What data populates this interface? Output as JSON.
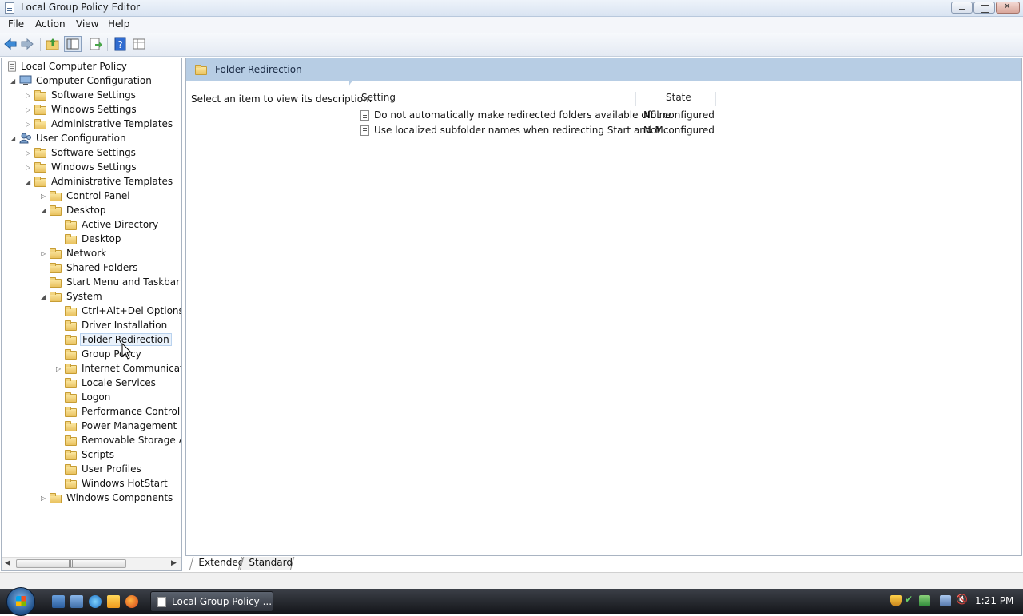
{
  "window": {
    "title": "Local Group Policy Editor"
  },
  "menu": [
    "File",
    "Action",
    "View",
    "Help"
  ],
  "tree": {
    "root": "Local Computer Policy",
    "items": [
      {
        "label": "Computer Configuration",
        "level": 1,
        "expander": "expanded",
        "icon": "computer-icon"
      },
      {
        "label": "Software Settings",
        "level": 2,
        "expander": "collapsed",
        "icon": "folder-icon"
      },
      {
        "label": "Windows Settings",
        "level": 2,
        "expander": "collapsed",
        "icon": "folder-icon"
      },
      {
        "label": "Administrative Templates",
        "level": 2,
        "expander": "collapsed",
        "icon": "folder-icon"
      },
      {
        "label": "User Configuration",
        "level": 1,
        "expander": "expanded",
        "icon": "user-icon"
      },
      {
        "label": "Software Settings",
        "level": 2,
        "expander": "collapsed",
        "icon": "folder-icon"
      },
      {
        "label": "Windows Settings",
        "level": 2,
        "expander": "collapsed",
        "icon": "folder-icon"
      },
      {
        "label": "Administrative Templates",
        "level": 2,
        "expander": "expanded",
        "icon": "folder-icon"
      },
      {
        "label": "Control Panel",
        "level": 3,
        "expander": "collapsed",
        "icon": "folder-icon"
      },
      {
        "label": "Desktop",
        "level": 3,
        "expander": "expanded",
        "icon": "folder-icon"
      },
      {
        "label": "Active Directory",
        "level": 4,
        "expander": "none",
        "icon": "folder-icon"
      },
      {
        "label": "Desktop",
        "level": 4,
        "expander": "none",
        "icon": "folder-icon"
      },
      {
        "label": "Network",
        "level": 3,
        "expander": "collapsed",
        "icon": "folder-icon"
      },
      {
        "label": "Shared Folders",
        "level": 3,
        "expander": "none",
        "icon": "folder-icon"
      },
      {
        "label": "Start Menu and Taskbar",
        "level": 3,
        "expander": "none",
        "icon": "folder-icon"
      },
      {
        "label": "System",
        "level": 3,
        "expander": "expanded",
        "icon": "folder-icon"
      },
      {
        "label": "Ctrl+Alt+Del Options",
        "level": 4,
        "expander": "none",
        "icon": "folder-icon"
      },
      {
        "label": "Driver Installation",
        "level": 4,
        "expander": "none",
        "icon": "folder-icon"
      },
      {
        "label": "Folder Redirection",
        "level": 4,
        "expander": "none",
        "icon": "folder-icon",
        "selected": true
      },
      {
        "label": "Group Policy",
        "level": 4,
        "expander": "none",
        "icon": "folder-icon"
      },
      {
        "label": "Internet Communicatio",
        "level": 4,
        "expander": "collapsed",
        "icon": "folder-icon"
      },
      {
        "label": "Locale Services",
        "level": 4,
        "expander": "none",
        "icon": "folder-icon"
      },
      {
        "label": "Logon",
        "level": 4,
        "expander": "none",
        "icon": "folder-icon"
      },
      {
        "label": "Performance Control Pa",
        "level": 4,
        "expander": "none",
        "icon": "folder-icon"
      },
      {
        "label": "Power Management",
        "level": 4,
        "expander": "none",
        "icon": "folder-icon"
      },
      {
        "label": "Removable Storage Acc",
        "level": 4,
        "expander": "none",
        "icon": "folder-icon"
      },
      {
        "label": "Scripts",
        "level": 4,
        "expander": "none",
        "icon": "folder-icon"
      },
      {
        "label": "User Profiles",
        "level": 4,
        "expander": "none",
        "icon": "folder-icon"
      },
      {
        "label": "Windows HotStart",
        "level": 4,
        "expander": "none",
        "icon": "folder-icon"
      },
      {
        "label": "Windows Components",
        "level": 3,
        "expander": "collapsed",
        "icon": "folder-icon"
      }
    ]
  },
  "details": {
    "header_title": "Folder Redirection",
    "description": "Select an item to view its description.",
    "columns": {
      "setting": "Setting",
      "state": "State"
    },
    "rows": [
      {
        "setting": "Do not automatically make redirected folders available offline",
        "state": "Not configured"
      },
      {
        "setting": "Use localized subfolder names when redirecting Start and M...",
        "state": "Not configured"
      }
    ]
  },
  "tabs": [
    "Extended",
    "Standard"
  ],
  "taskbar": {
    "task_label": "Local Group Policy ...",
    "clock": "1:21 PM"
  },
  "colors": {
    "header_band": "#b7cde4",
    "selection": "#eaf2fb"
  }
}
